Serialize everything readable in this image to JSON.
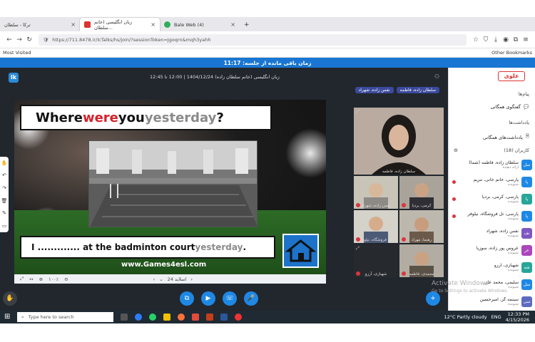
{
  "browser": {
    "tabs": [
      {
        "label": "ترکا - سلطان",
        "active": false
      },
      {
        "label": "زبان انگلیسی (خانم سلطان...",
        "active": true
      },
      {
        "label": "Bale Web (4)",
        "active": false
      }
    ],
    "new_tab": "+",
    "url": "https://711.8478.ir/lcTalks/hs/join/?sessionToken=Jgoqrn&mqh3yahh",
    "most_visited": "Most Visited",
    "other_bookmarks": "Other Bookmarks"
  },
  "timer": {
    "label": "زمان باقی مانده از جلسه: 11:17"
  },
  "stage": {
    "title": "زبان انگلیسی (خانم سلطان زاده) 1404/12/24 | 12:00 تا 12:45",
    "tags": [
      "سلطان زاده، فاطمه",
      "نفس زاده، شهراد"
    ],
    "logo": "lk"
  },
  "slide": {
    "title_parts": [
      "Where ",
      "were",
      " you ",
      "yesterday",
      "?"
    ],
    "sentence_parts": [
      "I ............. at the badminton court ",
      "yesterday",
      "."
    ],
    "url": "www.Games4esl.com",
    "toolbar": {
      "zoom": "۱۰۰٪",
      "page_label": "اسلاید 24"
    }
  },
  "videos": {
    "main_label": "سلطان زاده، فاطمه",
    "tiles": [
      {
        "label": "نفس زاده، شهراد"
      },
      {
        "label": "کرمی، بردیا"
      },
      {
        "label": "تل فروشگاه، نیلوفر"
      },
      {
        "label": "رهنما، مهراد"
      },
      {
        "label": "شهبازی، آرزو"
      },
      {
        "label": "محمدی، فاطمه"
      }
    ]
  },
  "sidebar": {
    "brand": "علوی",
    "sections": {
      "messages": "پیام‌ها",
      "group_chat": "گفتگوی همگانی",
      "notes": "یادداشت‌ها",
      "shared_notes": "یادداشت‌های همگانی",
      "users": "کاربران (18)"
    },
    "users": [
      {
        "name": "سلطان زاده، فاطمه (شما)",
        "role": "ارائه دهنده",
        "initials": "سل",
        "color": "#1e88e5"
      },
      {
        "name": "پارسی، خانم خانی، مریم",
        "role": "شنونده",
        "initials": "پا",
        "color": "#1e88e5"
      },
      {
        "name": "پارسی، کرمی، بردیا",
        "role": "شنونده",
        "initials": "پا",
        "color": "#26a69a"
      },
      {
        "name": "پارسی، تل فروشگاه، نیلوفر",
        "role": "شنونده",
        "initials": "پا",
        "color": "#1e88e5"
      },
      {
        "name": "نفس زاده، شهراد",
        "role": "شنونده",
        "initials": "نف",
        "color": "#7e57c2"
      },
      {
        "name": "عروس پور زاده، سوزیا",
        "role": "شنونده",
        "initials": "عر",
        "color": "#ab47bc"
      },
      {
        "name": "شهبازی، آرزو",
        "role": "شنونده",
        "initials": "شه",
        "color": "#26a69a"
      },
      {
        "name": "سلیمی، محمد علی",
        "role": "شنونده",
        "initials": "سل",
        "color": "#1e88e5"
      },
      {
        "name": "سینمه گر، امیرحسین",
        "role": "شنونده",
        "initials": "سی",
        "color": "#5c6bc0"
      }
    ],
    "watermark_title": "Activate Windows",
    "watermark_sub": "Go to Settings to activate Windows."
  },
  "taskbar": {
    "search_placeholder": "Type here to search",
    "weather": "12°C  Partly cloudy",
    "lang": "ENG",
    "time": "12:33 PM",
    "date": "4/15/2026"
  }
}
